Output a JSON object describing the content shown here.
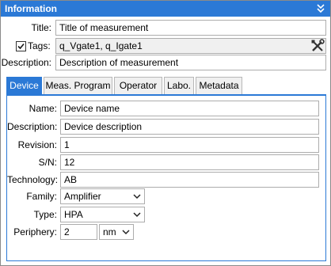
{
  "panel": {
    "title": "Information",
    "collapse_icon": "double-chevron-down-icon"
  },
  "form": {
    "title_label": "Title:",
    "title_value": "Title of measurement",
    "tags_label": "Tags:",
    "tags_checked": true,
    "tags_value": "q_Vgate1, q_Igate1",
    "tags_tool_icon": "tools-icon",
    "description_label": "Description:",
    "description_value": "Description of measurement"
  },
  "tabs": [
    {
      "label": "Device",
      "active": true
    },
    {
      "label": "Meas. Program",
      "active": false
    },
    {
      "label": "Operator",
      "active": false
    },
    {
      "label": "Labo.",
      "active": false
    },
    {
      "label": "Metadata",
      "active": false
    }
  ],
  "device": {
    "name_label": "Name:",
    "name_value": "Device name",
    "description_label": "Description:",
    "description_value": "Device description",
    "revision_label": "Revision:",
    "revision_value": "1",
    "sn_label": "S/N:",
    "sn_value": "12",
    "technology_label": "Technology:",
    "technology_value": "AB",
    "family_label": "Family:",
    "family_value": "Amplifier",
    "type_label": "Type:",
    "type_value": "HPA",
    "periphery_label": "Periphery:",
    "periphery_value": "2",
    "periphery_unit": "nm"
  },
  "colors": {
    "accent": "#2b79d6",
    "border": "#adadad"
  }
}
